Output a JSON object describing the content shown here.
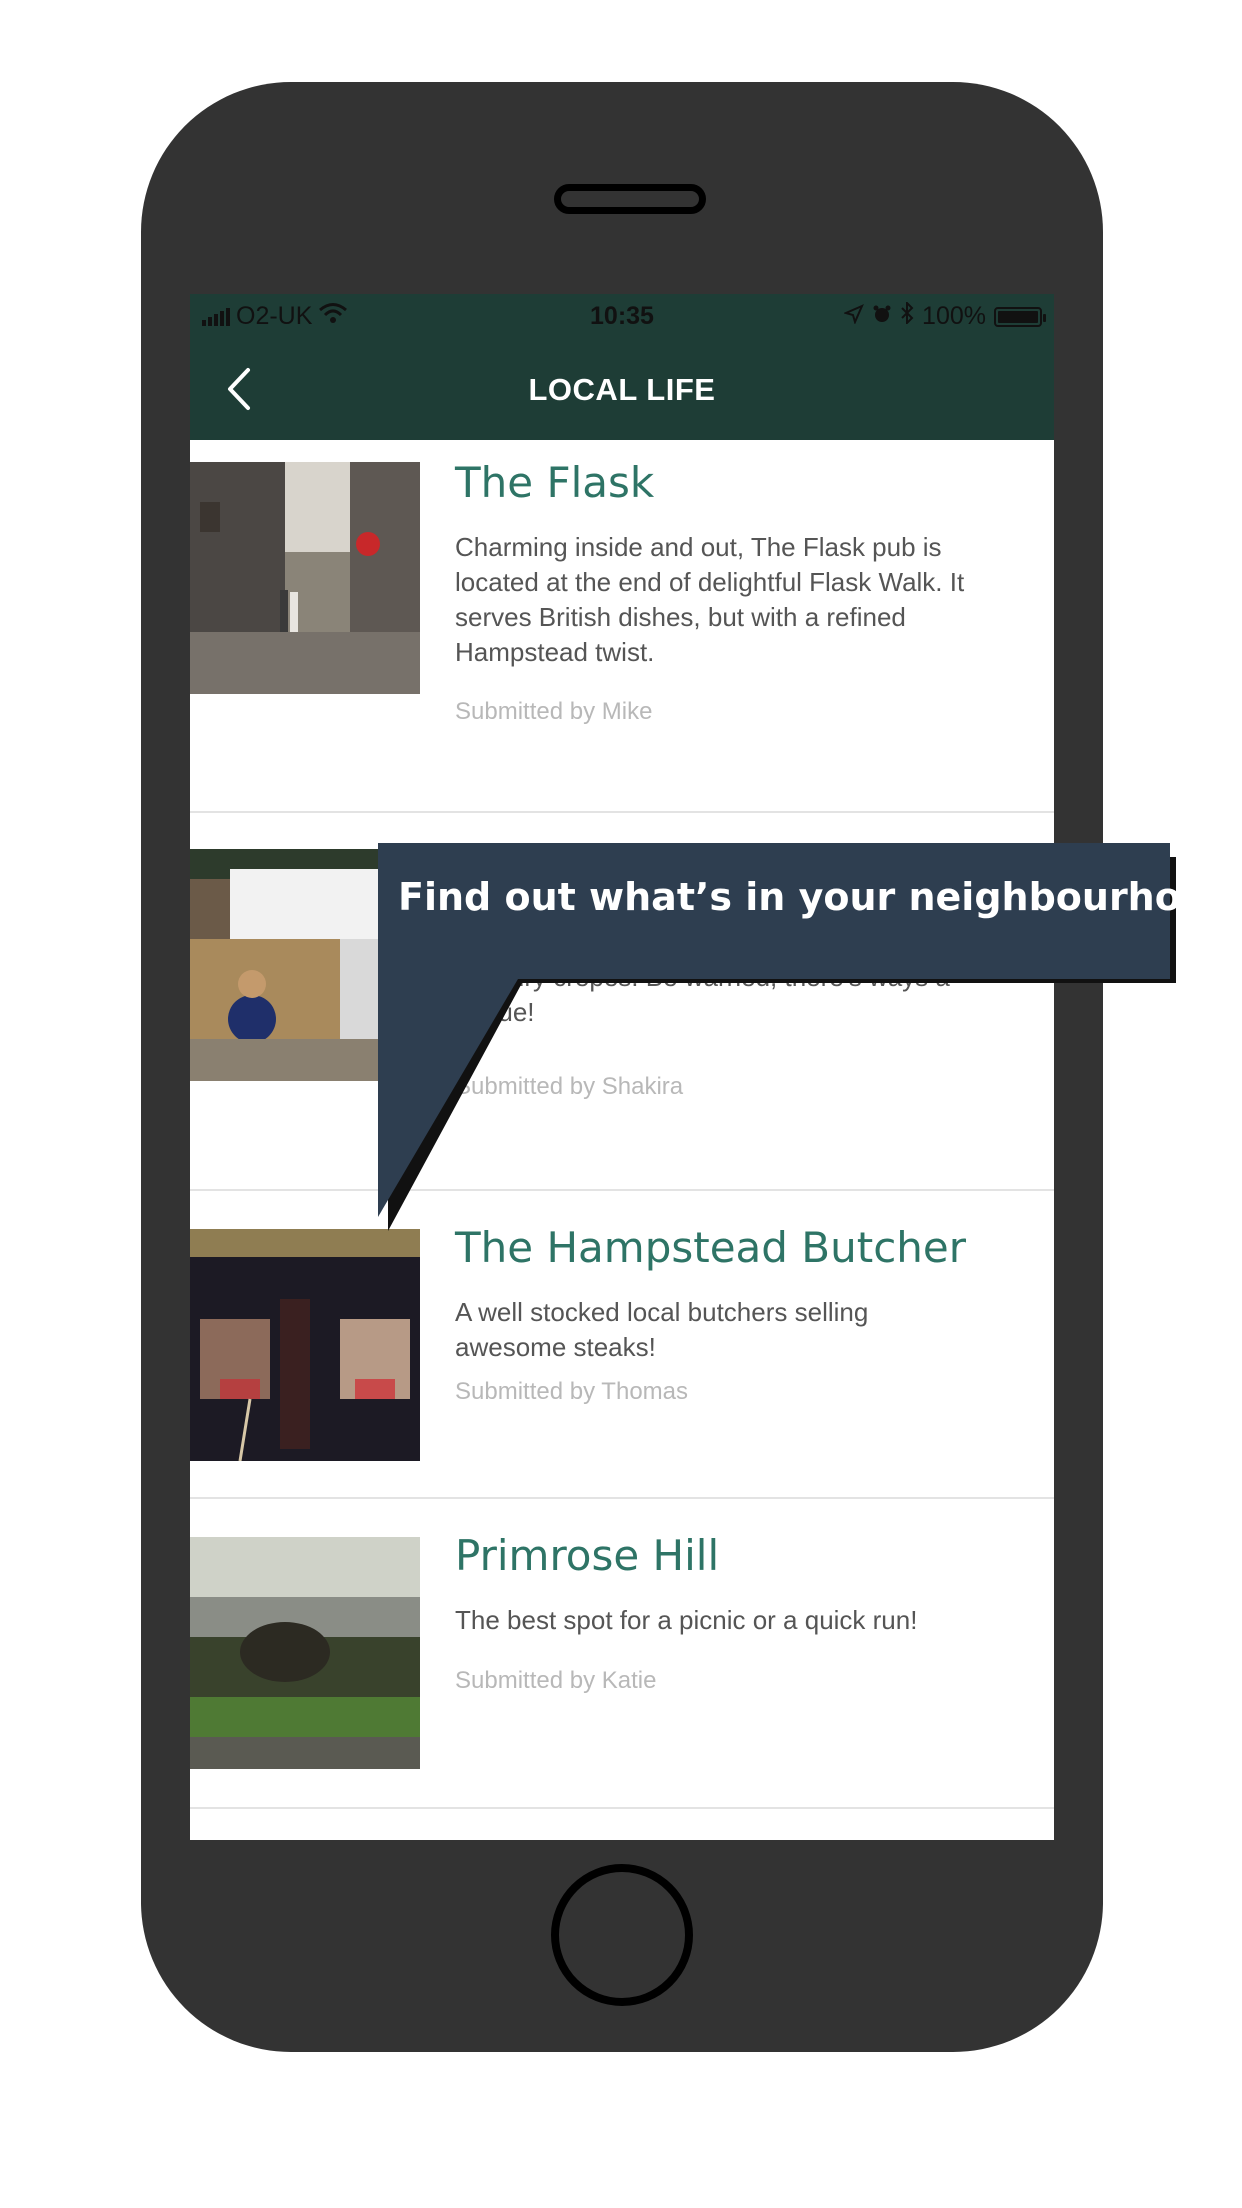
{
  "status_bar": {
    "carrier": "O2-UK",
    "time": "10:35",
    "battery": "100%",
    "icons": [
      "signal-bars-icon",
      "wifi-icon",
      "location-arrow-icon",
      "alarm-icon",
      "bluetooth-icon",
      "battery-icon"
    ]
  },
  "nav": {
    "title": "LOCAL LIFE",
    "back_icon": "chevron-left-icon"
  },
  "items": [
    {
      "title": "The Flask",
      "description": "Charming inside and out, The Flask pub is located at the end of delightful Flask Walk. It serves British dishes, but with a refined Hampstead twist.",
      "author": "Submitted by Mike"
    },
    {
      "title": "",
      "description": "savoury crepes. Be warned, there's ways a queue!",
      "author": "Submitted by Shakira"
    },
    {
      "title": "The Hampstead Butcher",
      "description": "A well stocked local butchers selling awesome steaks!",
      "author": "Submitted by Thomas"
    },
    {
      "title": "Primrose Hill",
      "description": "The best spot for a picnic or a quick run!",
      "author": "Submitted by Katie"
    },
    {
      "title": "",
      "description": "",
      "author": ""
    }
  ],
  "callout": {
    "text": "Find out what’s in your neighbourhood",
    "color": "#2e3e50"
  },
  "colors": {
    "nav_bg": "#1e3d36",
    "title_text": "#2e7466",
    "phone_body": "#333333"
  }
}
